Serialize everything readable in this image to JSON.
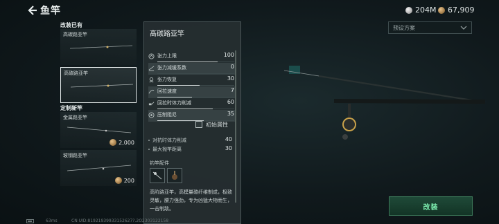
{
  "header": {
    "title": "鱼竿",
    "silver": "204M",
    "gold": "67,909"
  },
  "scheme": {
    "label": "预设方案"
  },
  "left": {
    "section_owned": "改装已有",
    "owned": [
      {
        "name": "高碳路亚竿"
      },
      {
        "name": "高碳路亚竿"
      }
    ],
    "section_craft": "定制新竿",
    "craft": [
      {
        "name": "金属路亚竿",
        "price": "2,000"
      },
      {
        "name": "玻钢路亚竿",
        "price": "200"
      }
    ]
  },
  "detail": {
    "title": "高碳路亚竿",
    "stats": [
      {
        "label": "张力上限",
        "value": "100",
        "fill": 0.78,
        "icon": "tension-icon"
      },
      {
        "label": "张力减缓系数",
        "value": "0",
        "fill": 0.0,
        "icon": "tension-reduce-icon"
      },
      {
        "label": "张力恢复",
        "value": "30",
        "fill": 0.55,
        "icon": "tension-recover-icon"
      },
      {
        "label": "回拉速度",
        "value": "7",
        "fill": 0.45,
        "icon": "pull-speed-icon"
      },
      {
        "label": "回拉时体力削减",
        "value": "60",
        "fill": 0.72,
        "icon": "pull-stamina-icon"
      },
      {
        "label": "压制阻尼",
        "value": "35",
        "fill": 0.6,
        "icon": "damping-icon"
      }
    ],
    "initial_attr": "初始属性",
    "extra": [
      {
        "label": "对抗时体力削减",
        "value": "40"
      },
      {
        "label": "最大抛竿距离",
        "value": "30"
      }
    ],
    "parts_label": "钓竿配件",
    "description": "高阶路亚竿，高模量碳纤维制成，极致灵敏，腰力强劲，专为凶猛大物而生，一击制敌。"
  },
  "install_label": "改装",
  "footer": {
    "fps": "63ms",
    "uid": "CN UID:81921939933152627?.2O2303122158"
  }
}
